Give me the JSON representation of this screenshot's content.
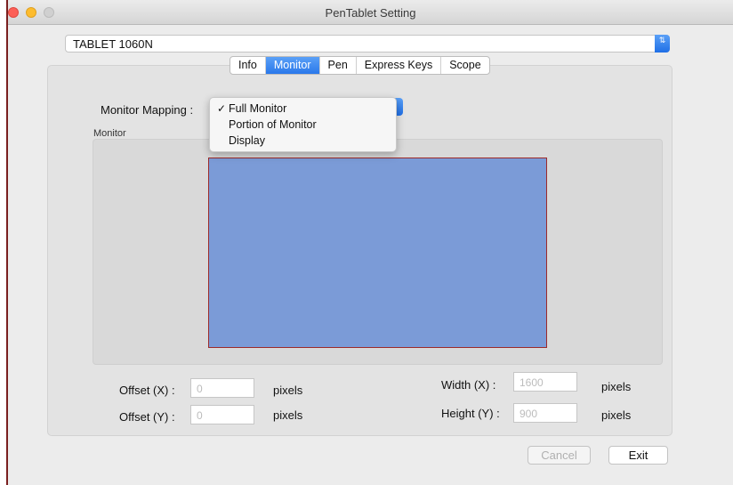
{
  "window": {
    "title": "PenTablet Setting"
  },
  "device": {
    "selected": "TABLET 1060N",
    "arrow": "⇅"
  },
  "tabs": [
    {
      "label": "Info",
      "active": false
    },
    {
      "label": "Monitor",
      "active": true
    },
    {
      "label": "Pen",
      "active": false
    },
    {
      "label": "Express Keys",
      "active": false
    },
    {
      "label": "Scope",
      "active": false
    }
  ],
  "monitor_mapping": {
    "label": "Monitor Mapping :",
    "options": [
      {
        "label": "Full Monitor",
        "checked": true,
        "check_mark": "✓"
      },
      {
        "label": "Portion of Monitor",
        "checked": false
      },
      {
        "label": "Display",
        "checked": false
      }
    ]
  },
  "monitor_group": {
    "label": "Monitor"
  },
  "fields": {
    "offset_x": {
      "label": "Offset (X) :",
      "value": "0",
      "unit": "pixels"
    },
    "offset_y": {
      "label": "Offset (Y) :",
      "value": "0",
      "unit": "pixels"
    },
    "width_x": {
      "label": "Width  (X) :",
      "value": "1600",
      "unit": "pixels"
    },
    "height_y": {
      "label": "Height (Y) :",
      "value": "900",
      "unit": "pixels"
    }
  },
  "buttons": {
    "cancel": "Cancel",
    "exit": "Exit"
  },
  "colors": {
    "accent": "#2a78ea",
    "mapped_area": "#7b9bd7",
    "area_border": "#9c2a2a"
  }
}
